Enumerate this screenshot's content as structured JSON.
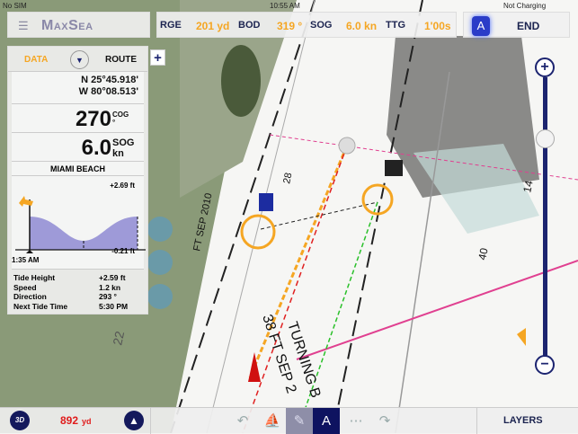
{
  "status": {
    "carrier": "No SIM",
    "time": "10:55 AM",
    "battery": "Not Charging"
  },
  "brand": {
    "menu_icon": "hamburger-icon",
    "logo": "MaxSea"
  },
  "nav": {
    "fields": [
      {
        "label": "RGE",
        "value": "201 yd"
      },
      {
        "label": "BOD",
        "value": "319 °"
      },
      {
        "label": "SOG",
        "value": "6.0 kn"
      },
      {
        "label": "TTG",
        "value": "1'00s"
      }
    ],
    "end_label": "END"
  },
  "panel": {
    "tab_data": "DATA",
    "tab_route": "ROUTE",
    "lat": "N 25°45.918'",
    "lon": "W 80°08.513'",
    "cog": {
      "value": "270",
      "label": "COG",
      "unit": "°"
    },
    "sog": {
      "value": "6.0",
      "label": "SOG",
      "unit": "kn"
    },
    "station": "MIAMI BEACH",
    "tide_chart": {
      "max": "+2.69 ft",
      "min": "-0.21 ft",
      "time": "1:35 AM"
    },
    "stats": [
      {
        "k": "Tide Height",
        "v": "+2.59 ft"
      },
      {
        "k": "Speed",
        "v": "1.2 kn"
      },
      {
        "k": "Direction",
        "v": "293 °"
      },
      {
        "k": "Next Tide Time",
        "v": "5:30 PM"
      }
    ]
  },
  "zoom": {
    "level": 0.2
  },
  "chart_labels": {
    "turning": "TURNING B",
    "depth": "38 FT SEP 2",
    "ftsep": "FT SEP 2010",
    "s28": "28",
    "s22": "22",
    "s14": "14",
    "s40": "40"
  },
  "bottom": {
    "btn_3d": "3D",
    "distance": "892",
    "distance_unit": "yd",
    "layers": "LAYERS"
  },
  "colors": {
    "accent": "#f5a623",
    "navy": "#1c2470",
    "distance": "#e01b1b"
  }
}
